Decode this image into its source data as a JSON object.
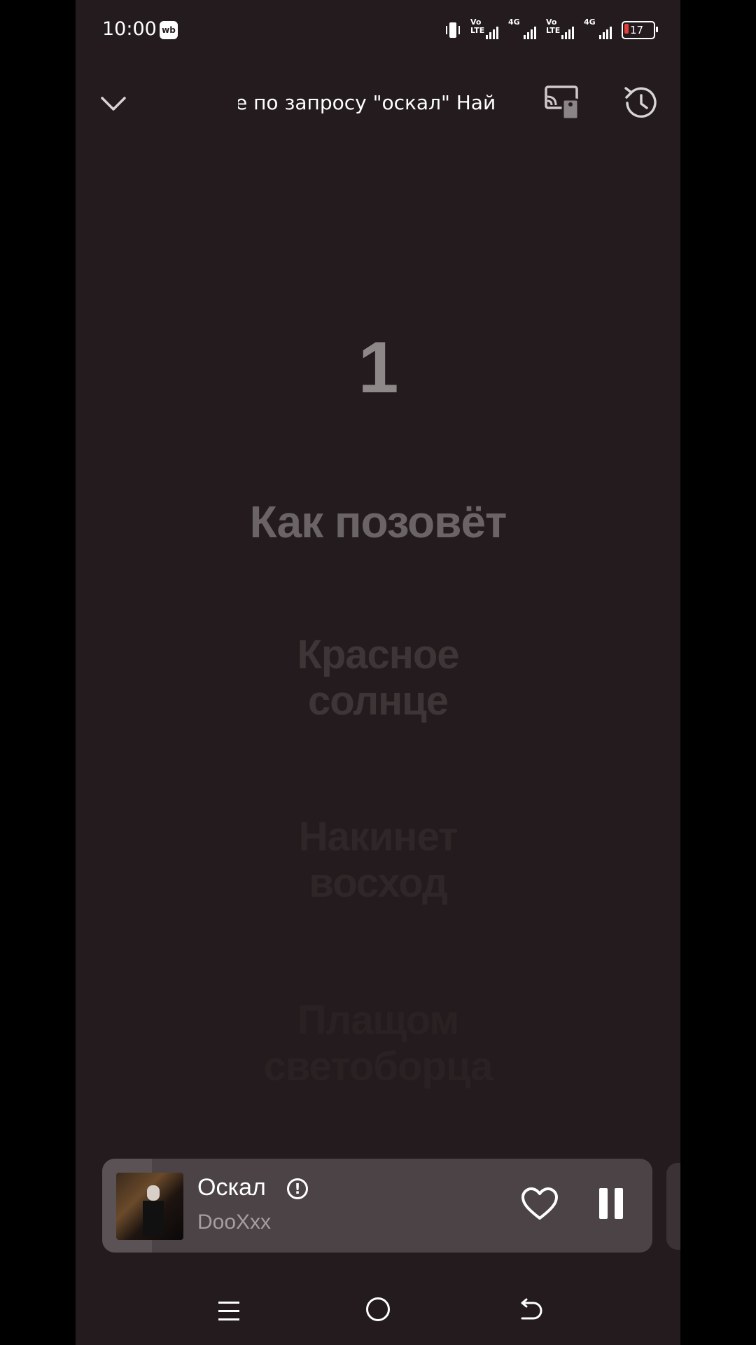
{
  "status_bar": {
    "time": "10:00",
    "app_badge": "wb",
    "sim1_label": "Vo\nLTE",
    "sim1_net": "4G",
    "sim2_label": "Vo\nLTE",
    "sim2_net": "4G",
    "battery": "17"
  },
  "header": {
    "marquee_text": "е по запросу \"оскал\"   Най"
  },
  "lyrics": {
    "countdown": "1",
    "line1": "Как позовёт",
    "line2": "Красное солнце",
    "line3": "Накинет восход",
    "line4": "Плащом светоборца"
  },
  "player": {
    "title": "Оскал",
    "artist": "DooXxx",
    "warning_glyph": "!",
    "progress_fraction": 0.09
  },
  "colors": {
    "background": "#231b1d",
    "player_bg": "#4b4345",
    "battery_low": "#e0403a"
  },
  "icons": [
    "chevron-down-icon",
    "cast-devices-icon",
    "history-icon",
    "warning-icon",
    "heart-icon",
    "pause-icon",
    "menu-icon",
    "home-icon",
    "back-icon"
  ]
}
